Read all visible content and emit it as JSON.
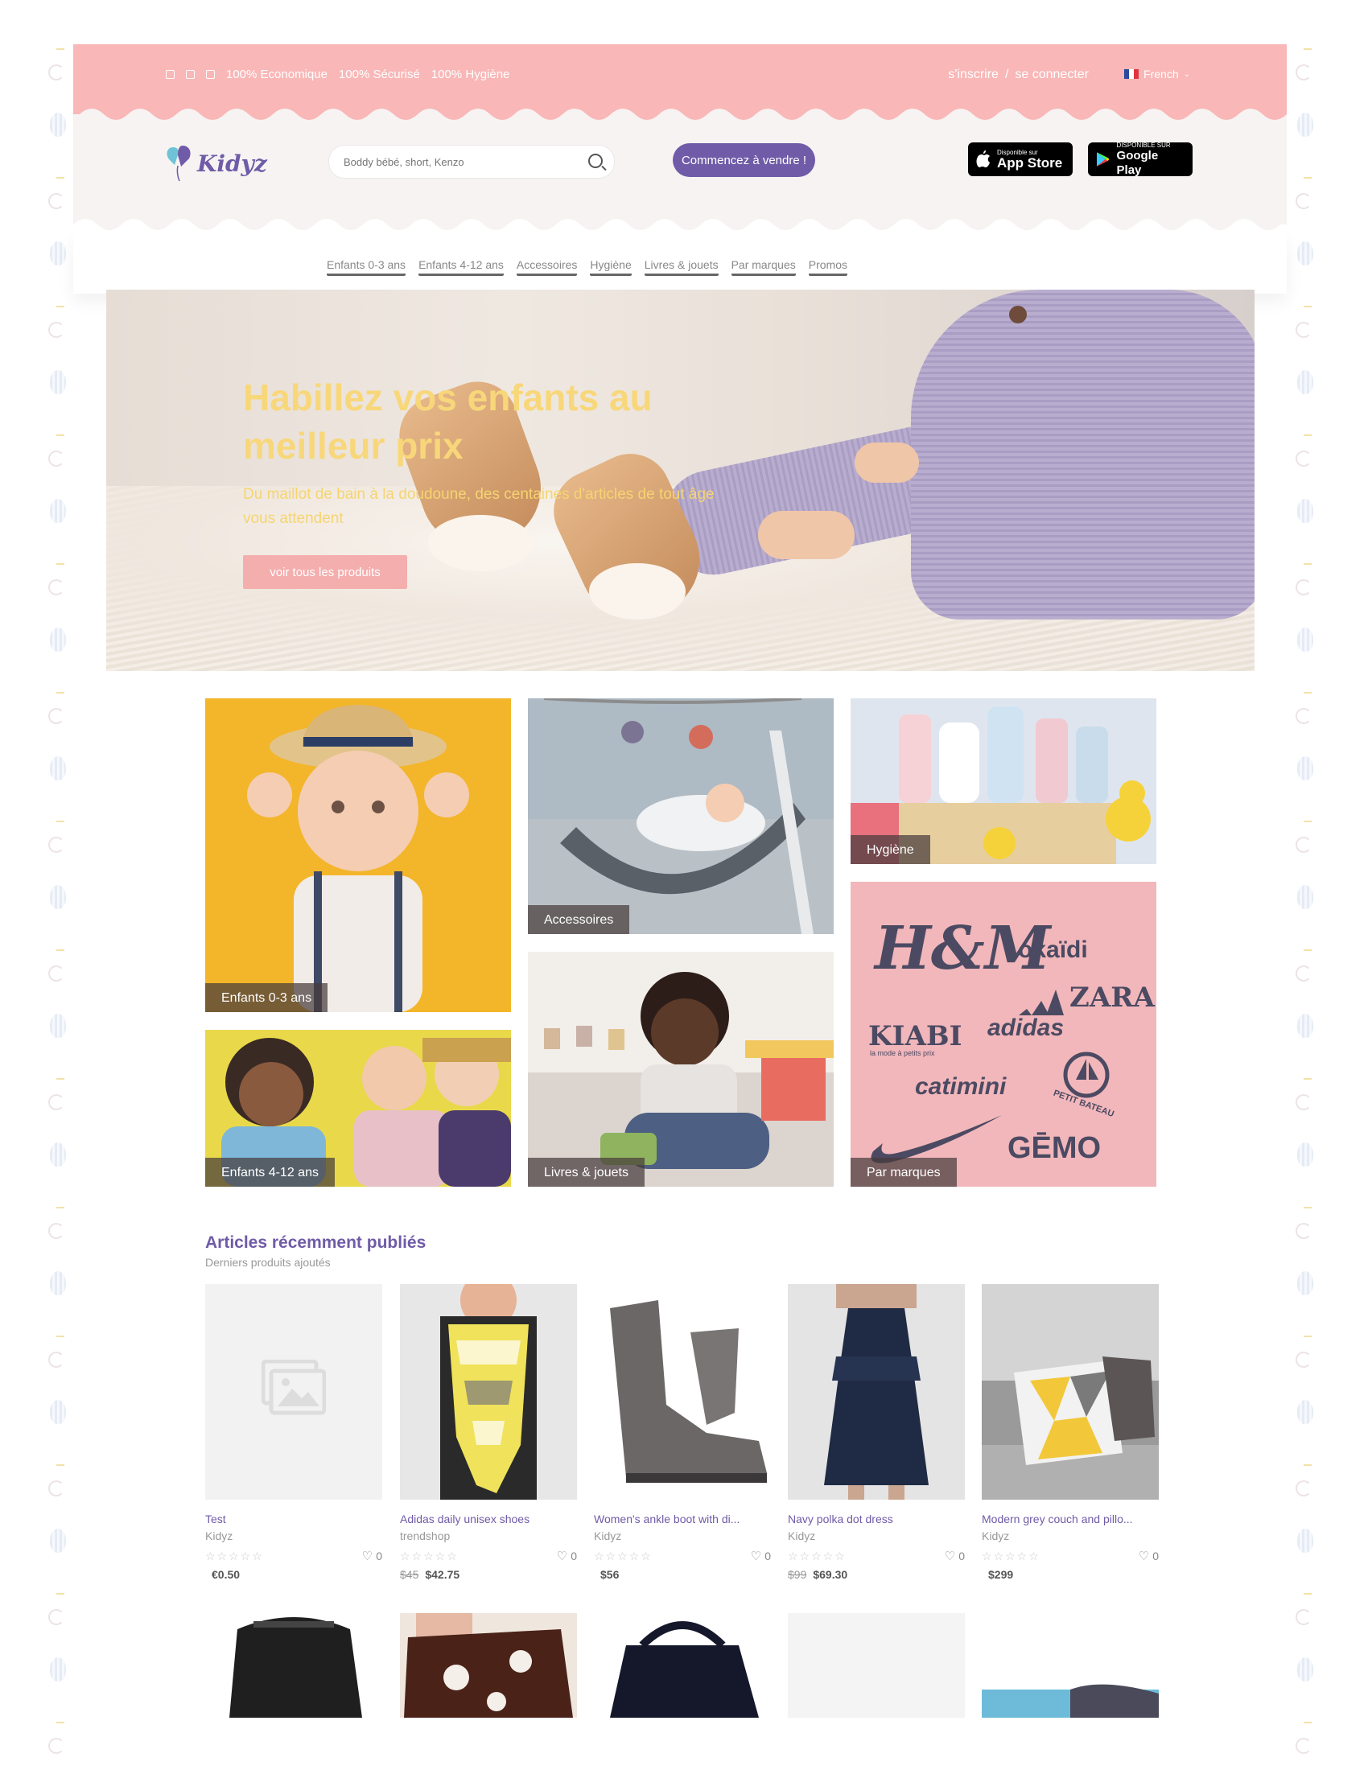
{
  "topbar": {
    "features": [
      "100% Economique",
      "100% Sécurisé",
      "100% Hygiène"
    ],
    "register": "s'inscrire",
    "separator": "/",
    "login": "se connecter",
    "language": "French"
  },
  "header": {
    "logo_text": "Kidyz",
    "search_placeholder": "Boddy bébé, short, Kenzo",
    "sell_button": "Commencez à vendre !",
    "appstore_small": "Disponible sur",
    "appstore_big": "App Store",
    "googleplay_small": "DISPONIBLE SUR",
    "googleplay_big": "Google Play"
  },
  "nav": [
    "Enfants 0-3 ans",
    "Enfants 4-12 ans",
    "Accessoires",
    "Hygiène",
    "Livres & jouets",
    "Par marques",
    "Promos"
  ],
  "hero": {
    "title": "Habillez vos enfants au meilleur prix",
    "subtitle": "Du maillot de bain à la doudoune, des centaines d'articles de tout âge vous attendent",
    "cta": "voir tous les produits"
  },
  "categories": {
    "c03": "Enfants 0-3 ans",
    "acc": "Accessoires",
    "hyg": "Hygiène",
    "c412": "Enfants 4-12 ans",
    "liv": "Livres & jouets",
    "brands": "Par marques"
  },
  "brands": [
    "H&M",
    "okaïdi",
    "ZARA",
    "KIABI",
    "la mode à petits prix",
    "adidas",
    "catimini",
    "PETIT BATEAU",
    "GĒMO"
  ],
  "recent": {
    "title": "Articles récemment publiés",
    "subtitle": "Derniers produits ajoutés",
    "products": [
      {
        "name": "Test",
        "seller": "Kidyz",
        "stars": "☆☆☆☆☆",
        "likes": "0",
        "old_price": "",
        "price": "€0.50"
      },
      {
        "name": "Adidas daily unisex shoes",
        "seller": "trendshop",
        "stars": "☆☆☆☆☆",
        "likes": "0",
        "old_price": "$45",
        "price": "$42.75"
      },
      {
        "name": "Women's ankle boot with di...",
        "seller": "Kidyz",
        "stars": "☆☆☆☆☆",
        "likes": "0",
        "old_price": "",
        "price": "$56"
      },
      {
        "name": "Navy polka dot dress",
        "seller": "Kidyz",
        "stars": "☆☆☆☆☆",
        "likes": "0",
        "old_price": "$99",
        "price": "$69.30"
      },
      {
        "name": "Modern grey couch and pillo...",
        "seller": "Kidyz",
        "stars": "☆☆☆☆☆",
        "likes": "0",
        "old_price": "",
        "price": "$299"
      }
    ]
  },
  "colors": {
    "pink": "#f9b7b7",
    "purple": "#6f5ba7",
    "hero_text": "#f8d77a"
  }
}
